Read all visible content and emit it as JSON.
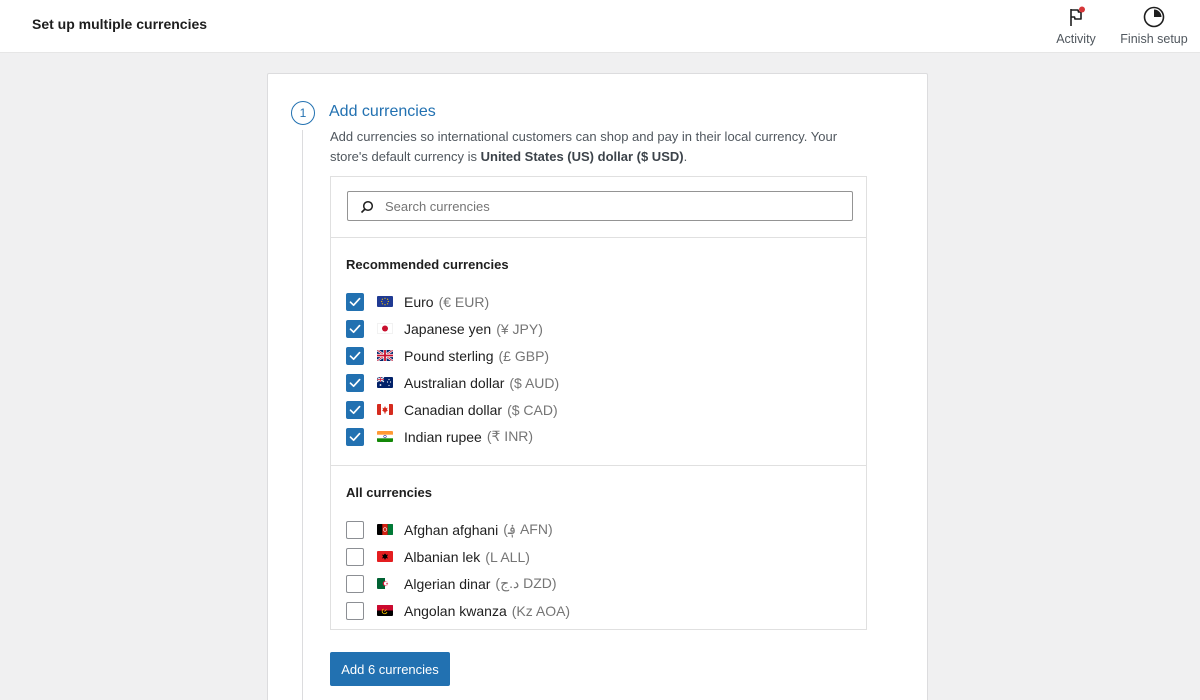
{
  "header": {
    "title": "Set up multiple currencies",
    "activity_label": "Activity",
    "finish_label": "Finish setup"
  },
  "step": {
    "number": "1",
    "title": "Add currencies",
    "description_text": "Add currencies so international customers can shop and pay in their local currency. Your store's default currency is ",
    "default_currency": "United States (US) dollar ($ USD)",
    "description_end": "."
  },
  "search": {
    "placeholder": "Search currencies",
    "value": ""
  },
  "recommended": {
    "title": "Recommended currencies",
    "items": [
      {
        "name": "Euro",
        "code": "(€ EUR)",
        "checked": true,
        "flag": "eu-flag"
      },
      {
        "name": "Japanese yen",
        "code": "(¥ JPY)",
        "checked": true,
        "flag": "jp-flag"
      },
      {
        "name": "Pound sterling",
        "code": "(£ GBP)",
        "checked": true,
        "flag": "gb-flag"
      },
      {
        "name": "Australian dollar",
        "code": "($ AUD)",
        "checked": true,
        "flag": "au-flag"
      },
      {
        "name": "Canadian dollar",
        "code": "($ CAD)",
        "checked": true,
        "flag": "ca-flag"
      },
      {
        "name": "Indian rupee",
        "code": "(₹ INR)",
        "checked": true,
        "flag": "in-flag"
      }
    ]
  },
  "all": {
    "title": "All currencies",
    "items": [
      {
        "name": "Afghan afghani",
        "code": "(؋ AFN)",
        "checked": false,
        "flag": "af-flag"
      },
      {
        "name": "Albanian lek",
        "code": "(L ALL)",
        "checked": false,
        "flag": "al-flag"
      },
      {
        "name": "Algerian dinar",
        "code": "(د.ج DZD)",
        "checked": false,
        "flag": "dz-flag"
      },
      {
        "name": "Angolan kwanza",
        "code": "(Kz AOA)",
        "checked": false,
        "flag": "ao-flag"
      }
    ]
  },
  "add_button_label": "Add 6 currencies",
  "colors": {
    "accent": "#2271b1",
    "notification": "#d63638"
  }
}
